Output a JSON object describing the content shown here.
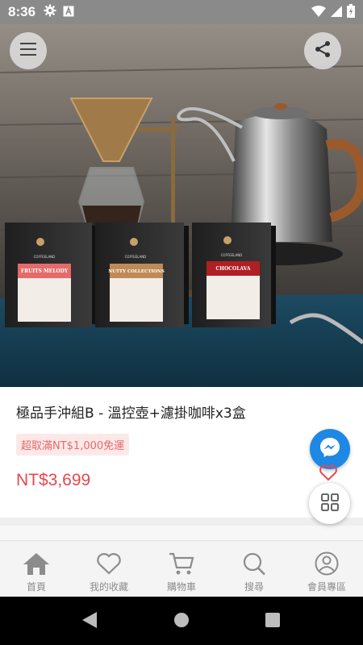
{
  "status_bar": {
    "time": "8:36",
    "icons": [
      "gear-icon",
      "a-box-icon",
      "wifi-icon",
      "signal-icon",
      "battery-icon"
    ]
  },
  "hero": {
    "boxes": [
      {
        "brand": "COFFEELAND",
        "name": "FRUITS MELODY",
        "color": "#e56a6a"
      },
      {
        "brand": "COFFEELAND",
        "name": "NUTTY COLLECTIONS",
        "color": "#c08a56"
      },
      {
        "brand": "COFFEELAND",
        "name": "CHOCOLAVA",
        "color": "#b01f24"
      }
    ]
  },
  "product": {
    "title": "極品手沖組B - 溫控壺+濾掛咖啡x3盒",
    "promo": "超取滿NT$1,000免運",
    "price": "NT$3,699"
  },
  "bottom_nav": {
    "items": [
      {
        "label": "首頁",
        "icon": "home-icon"
      },
      {
        "label": "我的收藏",
        "icon": "heart-icon"
      },
      {
        "label": "購物車",
        "icon": "cart-icon"
      },
      {
        "label": "搜尋",
        "icon": "search-icon"
      },
      {
        "label": "會員專區",
        "icon": "user-icon"
      }
    ]
  },
  "colors": {
    "price": "#e5484d",
    "promo_bg": "#fde8e8",
    "promo_text": "#e56a6a",
    "messenger": "#1e88e5",
    "status_bar": "#8a8a8a"
  }
}
